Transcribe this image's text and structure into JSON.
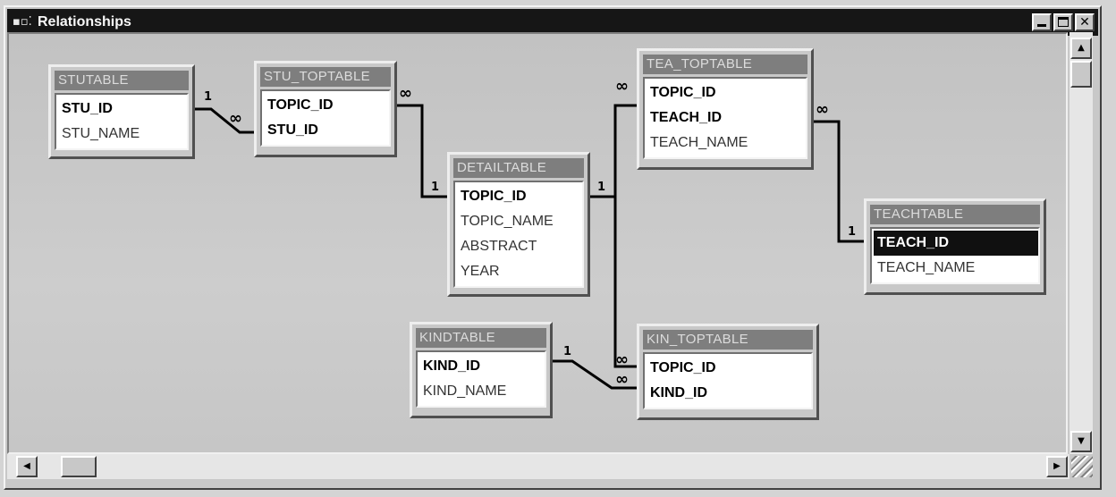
{
  "window": {
    "title": "Relationships",
    "title_icon": "relationships-icon"
  },
  "tables": {
    "stutable": {
      "name": "STUTABLE",
      "fields": [
        "STU_ID",
        "STU_NAME"
      ]
    },
    "stu_toptable": {
      "name": "STU_TOPTABLE",
      "fields": [
        "TOPIC_ID",
        "STU_ID"
      ]
    },
    "detailtable": {
      "name": "DETAILTABLE",
      "fields": [
        "TOPIC_ID",
        "TOPIC_NAME",
        "ABSTRACT",
        "YEAR"
      ]
    },
    "tea_toptable": {
      "name": "TEA_TOPTABLE",
      "fields": [
        "TOPIC_ID",
        "TEACH_ID",
        "TEACH_NAME"
      ]
    },
    "teachtable": {
      "name": "TEACHTABLE",
      "fields": [
        "TEACH_ID",
        "TEACH_NAME"
      ]
    },
    "kindtable": {
      "name": "KINDTABLE",
      "fields": [
        "KIND_ID",
        "KIND_NAME"
      ]
    },
    "kin_toptable": {
      "name": "KIN_TOPTABLE",
      "fields": [
        "TOPIC_ID",
        "KIND_ID"
      ]
    }
  },
  "cardinality": {
    "one": "1",
    "many": "∞"
  },
  "scrollbars": {
    "up": "▲",
    "down": "▼",
    "left": "◀",
    "right": "▶"
  }
}
